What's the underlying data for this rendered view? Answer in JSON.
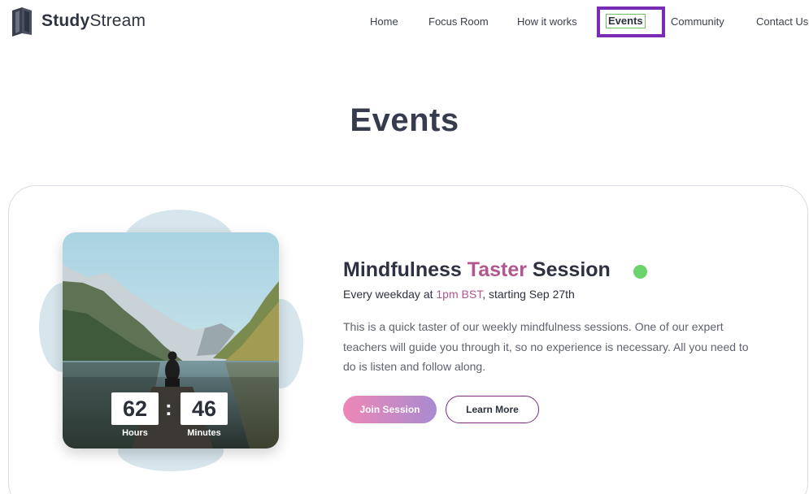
{
  "header": {
    "logo": {
      "bold": "Study",
      "light": "Stream",
      "icon": "book-icon"
    },
    "nav": [
      {
        "label": "Home"
      },
      {
        "label": "Focus Room"
      },
      {
        "label": "How it works"
      },
      {
        "label": "Events",
        "active": true
      },
      {
        "label": "Community"
      },
      {
        "label": "Contact Us"
      }
    ]
  },
  "page": {
    "title": "Events"
  },
  "session": {
    "title_part1": "Mindfulness ",
    "title_accent": "Taster",
    "title_part2": " Session",
    "status": "live",
    "schedule_part1": "Every weekday at ",
    "schedule_accent": "1pm BST",
    "schedule_part2": ", starting Sep 27th",
    "description": "This is a quick taster of our weekly mindfulness sessions. One of our expert teachers will guide you through it, so no experience is necessary. All you need to do is listen and follow along.",
    "countdown": {
      "hours": "62",
      "minutes": "46",
      "hours_label": "Hours",
      "minutes_label": "Minutes",
      "separator": ":"
    },
    "join_label": "Join Session",
    "learn_label": "Learn More"
  },
  "colors": {
    "accent": "#b2568e",
    "status_dot": "#6cd36b",
    "highlight_border": "#7a2bb4"
  }
}
